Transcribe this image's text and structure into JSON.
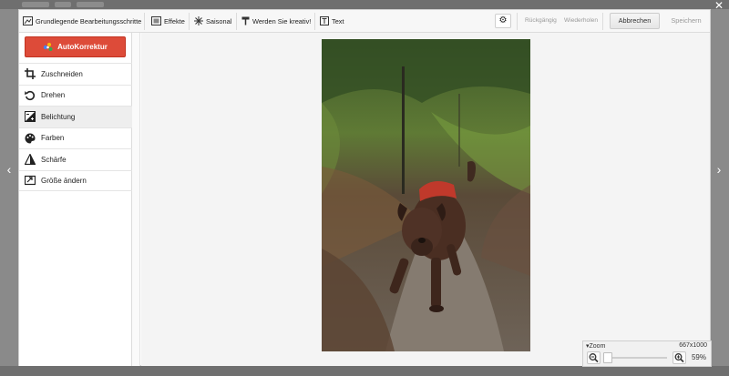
{
  "toolbar": {
    "tab_basic": "Grundlegende Bearbeitungsschritte",
    "tab_effects": "Effekte",
    "tab_seasonal": "Saisonal",
    "tab_creative": "Werden Sie kreativ!",
    "tab_text": "Text",
    "undo": "Rückgängig",
    "redo": "Wiederholen",
    "cancel": "Abbrechen",
    "save": "Speichern"
  },
  "sidebar": {
    "auto_button": "AutoKorrektur",
    "items": [
      {
        "label": "Zuschneiden",
        "icon": "crop-icon"
      },
      {
        "label": "Drehen",
        "icon": "rotate-icon"
      },
      {
        "label": "Belichtung",
        "icon": "exposure-icon",
        "active": true
      },
      {
        "label": "Farben",
        "icon": "palette-icon"
      },
      {
        "label": "Schärfe",
        "icon": "sharpness-icon"
      },
      {
        "label": "Größe ändern",
        "icon": "resize-icon"
      }
    ]
  },
  "zoom": {
    "label": "Zoom",
    "dimensions": "667x1000",
    "percent": "59%"
  },
  "colors": {
    "accent": "#dd4b39",
    "canvas_bg": "#f4f4f4",
    "toolbar_bg": "#f7f7f7"
  }
}
